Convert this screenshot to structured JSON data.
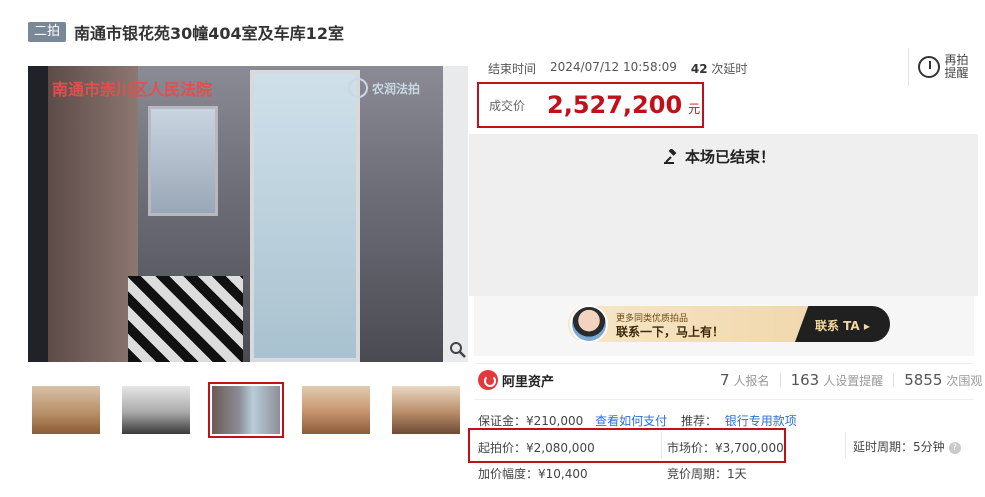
{
  "title": {
    "badge": "二拍",
    "text": "南通市银花苑30幢404室及车库12室"
  },
  "image": {
    "court_watermark": "南通市崇川区人民法院",
    "brand_watermark": "农润法拍",
    "thumbnails": [
      {
        "name": "thumb-1",
        "selected": false
      },
      {
        "name": "thumb-2",
        "selected": false
      },
      {
        "name": "thumb-3",
        "selected": true
      },
      {
        "name": "thumb-4",
        "selected": false
      },
      {
        "name": "thumb-5",
        "selected": false
      }
    ]
  },
  "auction": {
    "end_label": "结束时间",
    "end_time": "2024/07/12 10:58:09",
    "delay_count": "42",
    "delay_suffix": "次延时",
    "remind_line1": "再拍",
    "remind_line2": "提醒",
    "deal_label": "成交价",
    "deal_price": "2,527,200",
    "deal_unit": "元",
    "ended_message": "本场已结束！"
  },
  "banner": {
    "line1": "更多同类优质拍品",
    "line2": "联系一下，马上有！",
    "button": "联系 TA ▸"
  },
  "brand": {
    "name": "阿里资产"
  },
  "stats": {
    "signups": "7",
    "signups_label": "人报名",
    "reminders": "163",
    "reminders_label": "人设置提醒",
    "views": "5855",
    "views_label": "次围观"
  },
  "details": {
    "deposit": "保证金：¥210,000",
    "deposit_link": "查看如何支付",
    "recommend_label": "推荐：",
    "recommend_link": "银行专用款项",
    "start_price": "起拍价：¥2,080,000",
    "market_price": "市场价：¥3,700,000",
    "delay_period": "延时周期：5分钟",
    "increment": "加价幅度：¥10,400",
    "bid_period": "竞价周期：1天"
  },
  "colors": {
    "accent_red": "#c0101a",
    "link_blue": "#2a6fd6"
  }
}
